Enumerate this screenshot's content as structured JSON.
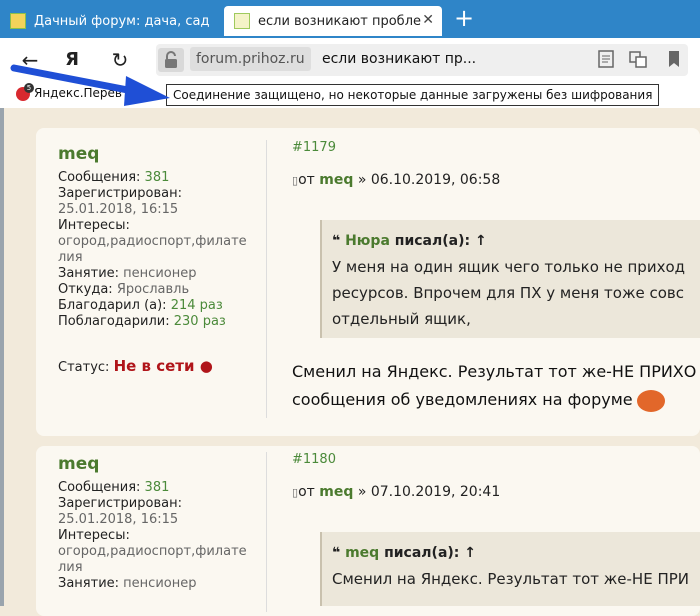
{
  "tabs": [
    {
      "title": "Дачный форум: дача, сад",
      "icon": "page-icon"
    },
    {
      "title": "если возникают пробле",
      "icon": "page-icon"
    }
  ],
  "toolbar": {
    "domain": "forum.prihoz.ru",
    "page_title": "если возникают пр...",
    "lock_icon": "lock-warning-icon"
  },
  "bookmarks": {
    "items": [
      {
        "label": "Яндекс.Перев",
        "badge": "5"
      }
    ]
  },
  "tooltip": "Соединение защищено, но некоторые данные загружены без шифрования",
  "posts": [
    {
      "author": "meq",
      "messages_label": "Сообщения:",
      "messages": "381",
      "registered_label": "Зарегистрирован:",
      "registered": "25.01.2018, 16:15",
      "interests_label": "Интересы:",
      "interests_line1": "огород,радиоспорт,филате",
      "interests_line2": "лия",
      "occupation_label": "Занятие:",
      "occupation": "пенсионер",
      "from_label": "Откуда:",
      "from": "Ярославль",
      "thanked_label": "Благодарил (а):",
      "thanked": "214 раз",
      "thanks_label": "Поблагодарили:",
      "thanks": "230 раз",
      "status_label": "Статус:",
      "status": "Не в сети ●",
      "number": "#1179",
      "meta_prefix": "от",
      "meta_author": "meq",
      "meta_date": "» 06.10.2019, 06:58",
      "quote_author": "Нюра",
      "quote_suffix": "писал(а): ↑",
      "quote_lines": [
        "У меня на один ящик чего только не приход",
        "ресурсов. Впрочем для ПХ у меня тоже совс",
        "отдельный ящик,"
      ],
      "text_lines": [
        "Сменил на Яндекс. Результат тот же-НЕ ПРИХО",
        "сообщения об уведомлениях на форуме"
      ]
    },
    {
      "author": "meq",
      "messages_label": "Сообщения:",
      "messages": "381",
      "registered_label": "Зарегистрирован:",
      "registered": "25.01.2018, 16:15",
      "interests_label": "Интересы:",
      "interests_line1": "огород,радиоспорт,филате",
      "interests_line2": "лия",
      "occupation_label": "Занятие:",
      "occupation": "пенсионер",
      "number": "#1180",
      "meta_prefix": "от",
      "meta_author": "meq",
      "meta_date": "» 07.10.2019, 20:41",
      "quote_author": "meq",
      "quote_suffix": "писал(а): ↑",
      "quote_lines": [
        "Сменил на Яндекс. Результат тот же-НЕ ПРИ"
      ]
    }
  ],
  "colors": {
    "tabbar": "#2f85c8",
    "accent_green": "#4b8a3a",
    "offline_red": "#b0151a",
    "arrow_blue": "#1f4fd6"
  }
}
